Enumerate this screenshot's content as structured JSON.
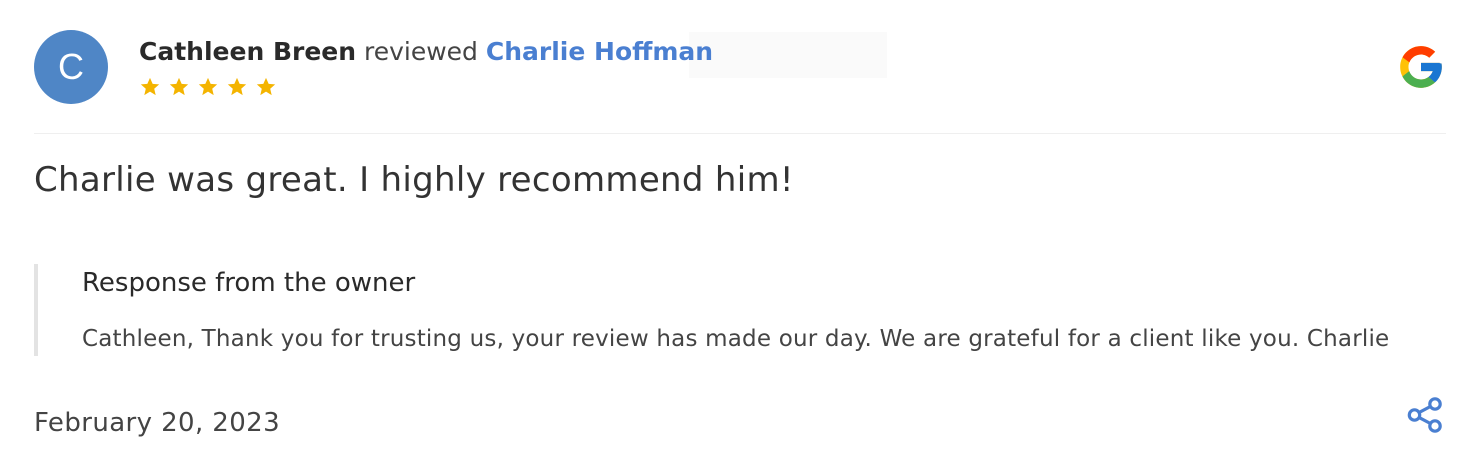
{
  "review": {
    "avatar_initial": "C",
    "reviewer_name": "Cathleen Breen",
    "reviewed_word": "reviewed",
    "business_name": "Charlie Hoffman",
    "rating": 5,
    "rating_max": 5,
    "source_icon": "google-g-icon",
    "text": "Charlie was great. I highly recommend him!",
    "date": "February 20, 2023"
  },
  "owner_response": {
    "title": "Response from the owner",
    "text": "Cathleen, Thank you for trusting us, your review has made our day. We are grateful for a client like you. Charlie"
  },
  "actions": {
    "share_icon": "share-icon"
  },
  "colors": {
    "avatar": "#4f86c6",
    "link": "#4a7fd1",
    "star": "#f4b400",
    "share": "#4a7fd1",
    "google_blue": "#4285F4",
    "google_red": "#EA4335",
    "google_yellow": "#FBBC05",
    "google_green": "#34A853"
  }
}
